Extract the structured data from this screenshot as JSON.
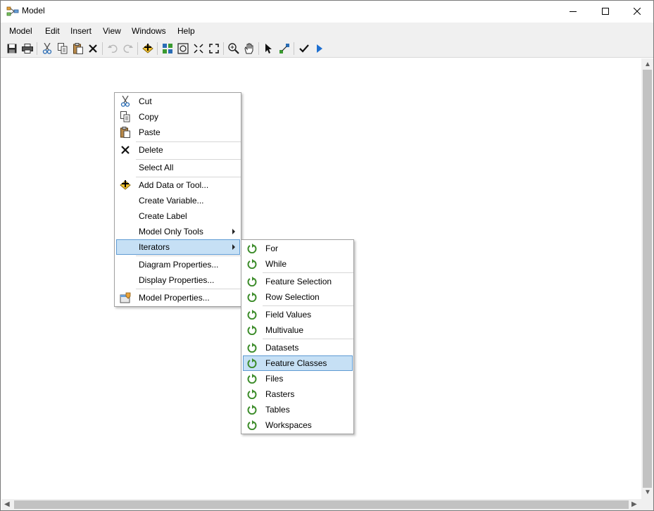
{
  "window": {
    "title": "Model",
    "icon": "model-builder-icon",
    "controls": [
      "minimize-icon",
      "maximize-icon",
      "close-icon"
    ]
  },
  "menubar": {
    "items": [
      "Model",
      "Edit",
      "Insert",
      "View",
      "Windows",
      "Help"
    ]
  },
  "toolbar": {
    "buttons": [
      "save-icon",
      "print-icon",
      "cut-icon",
      "copy-icon",
      "paste-icon",
      "delete-icon",
      "undo-icon",
      "redo-icon",
      "add-data-icon",
      "auto-layout-icon",
      "full-extent-icon",
      "fixed-zoom-in-icon",
      "fixed-zoom-out-icon",
      "zoom-icon",
      "pan-icon",
      "select-icon",
      "connect-icon",
      "validate-icon",
      "run-icon"
    ]
  },
  "context_menu": {
    "items": [
      {
        "label": "Cut",
        "icon": "cut-icon"
      },
      {
        "label": "Copy",
        "icon": "copy-icon"
      },
      {
        "label": "Paste",
        "icon": "paste-icon"
      },
      {
        "label": "Delete",
        "icon": "delete-icon"
      },
      {
        "label": "Select All",
        "icon": ""
      },
      {
        "label": "Add Data or Tool...",
        "icon": "add-data-icon"
      },
      {
        "label": "Create Variable...",
        "icon": ""
      },
      {
        "label": "Create Label",
        "icon": ""
      },
      {
        "label": "Model Only Tools",
        "icon": "",
        "submenu": true
      },
      {
        "label": "Iterators",
        "icon": "",
        "submenu": true,
        "highlighted": true
      },
      {
        "label": "Diagram Properties...",
        "icon": ""
      },
      {
        "label": "Display Properties...",
        "icon": ""
      },
      {
        "label": "Model Properties...",
        "icon": "properties-icon"
      }
    ]
  },
  "submenu": {
    "items": [
      {
        "label": "For",
        "icon": "iterator-icon"
      },
      {
        "label": "While",
        "icon": "iterator-icon"
      },
      {
        "label": "Feature Selection",
        "icon": "iterator-icon"
      },
      {
        "label": "Row Selection",
        "icon": "iterator-icon"
      },
      {
        "label": "Field Values",
        "icon": "iterator-icon"
      },
      {
        "label": "Multivalue",
        "icon": "iterator-icon"
      },
      {
        "label": "Datasets",
        "icon": "iterator-icon"
      },
      {
        "label": "Feature Classes",
        "icon": "iterator-icon",
        "highlighted": true
      },
      {
        "label": "Files",
        "icon": "iterator-icon"
      },
      {
        "label": "Rasters",
        "icon": "iterator-icon"
      },
      {
        "label": "Tables",
        "icon": "iterator-icon"
      },
      {
        "label": "Workspaces",
        "icon": "iterator-icon"
      }
    ]
  },
  "colors": {
    "highlight_bg": "#c6e0f5",
    "highlight_border": "#5f9bd3",
    "iterator_green": "#3c8c2a",
    "run_blue": "#1e6fd0"
  }
}
